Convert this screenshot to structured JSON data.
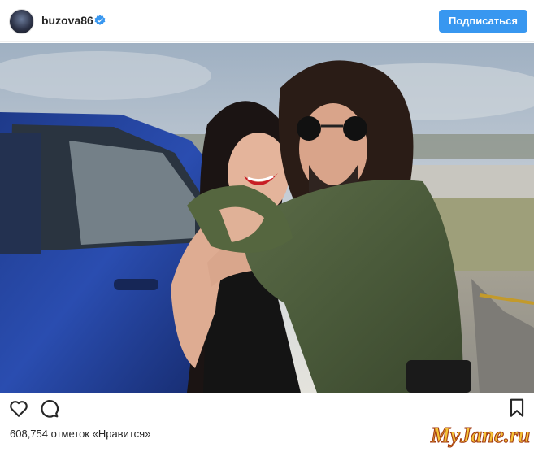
{
  "header": {
    "username": "buzova86",
    "verified": true,
    "follow_label": "Подписаться",
    "accent_color": "#3897f0"
  },
  "post": {
    "image_alt": "photo",
    "likes_count": "608,754",
    "likes_text": "отметок «Нравится»"
  },
  "actions": {
    "like_icon": "heart-icon",
    "comment_icon": "comment-icon",
    "save_icon": "bookmark-icon"
  },
  "watermark": {
    "text": "MyJane.ru"
  }
}
